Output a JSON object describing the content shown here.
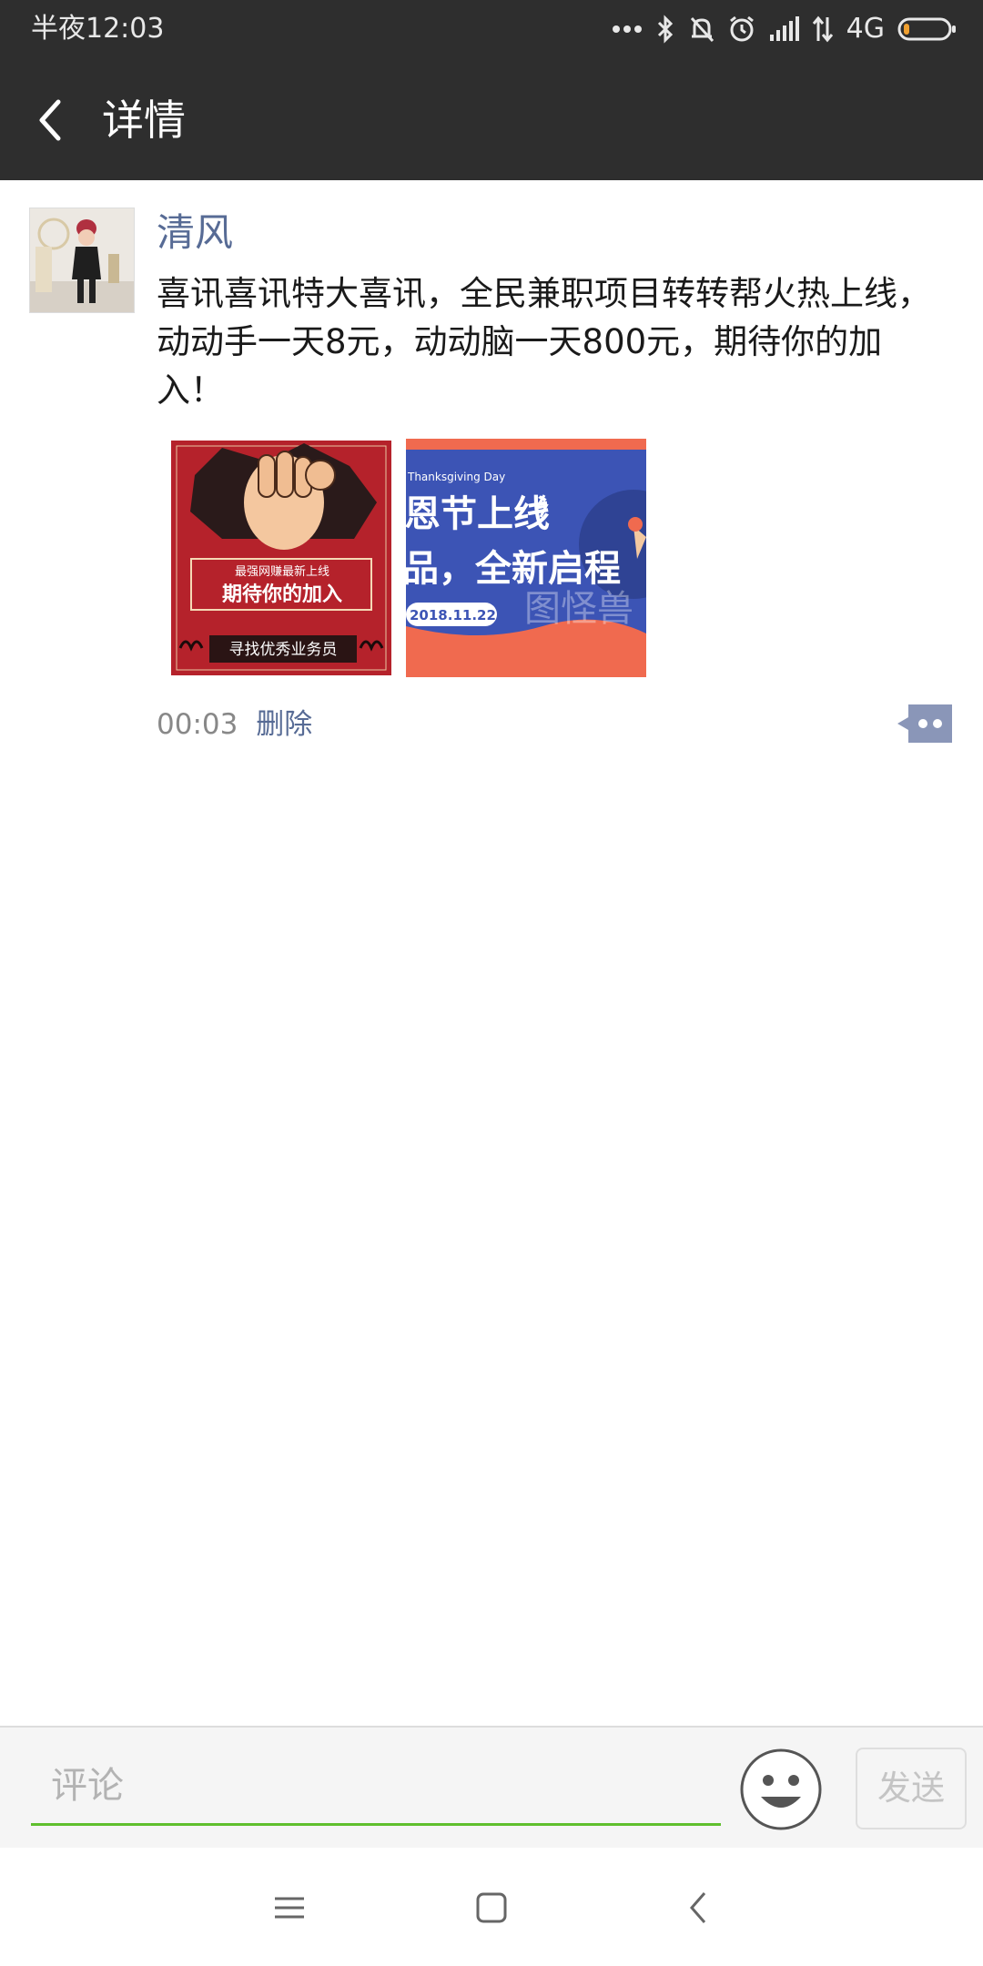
{
  "status_bar": {
    "time": "半夜12:03",
    "network": "4G",
    "icons": [
      "more-dots-icon",
      "bluetooth-icon",
      "mute-bell-icon",
      "alarm-icon",
      "signal-icon",
      "data-arrows-icon",
      "battery-icon"
    ]
  },
  "header": {
    "title": "详情",
    "back_icon": "back-arrow-icon"
  },
  "post": {
    "author": "清风",
    "text": "喜讯喜讯特大喜讯，全民兼职项目转转帮火热上线，动动手一天8元，动动脑一天800元，期待你的加入！",
    "time": "00:03",
    "delete_label": "删除",
    "images": [
      {
        "line1": "最强网赚最新上线",
        "line2": "期待你的加入",
        "line3": "寻找优秀业务员"
      },
      {
        "line_en": "Thanksgiving Day",
        "line1": "恩节上线",
        "line2": "品，全新启程",
        "date": "2018.11.22",
        "watermark": "图怪兽"
      }
    ]
  },
  "comment_bar": {
    "placeholder": "评论",
    "send_label": "发送"
  },
  "colors": {
    "bar_bg": "#2e2e2e",
    "link": "#576b95",
    "input_underline": "#5fbf2d"
  }
}
